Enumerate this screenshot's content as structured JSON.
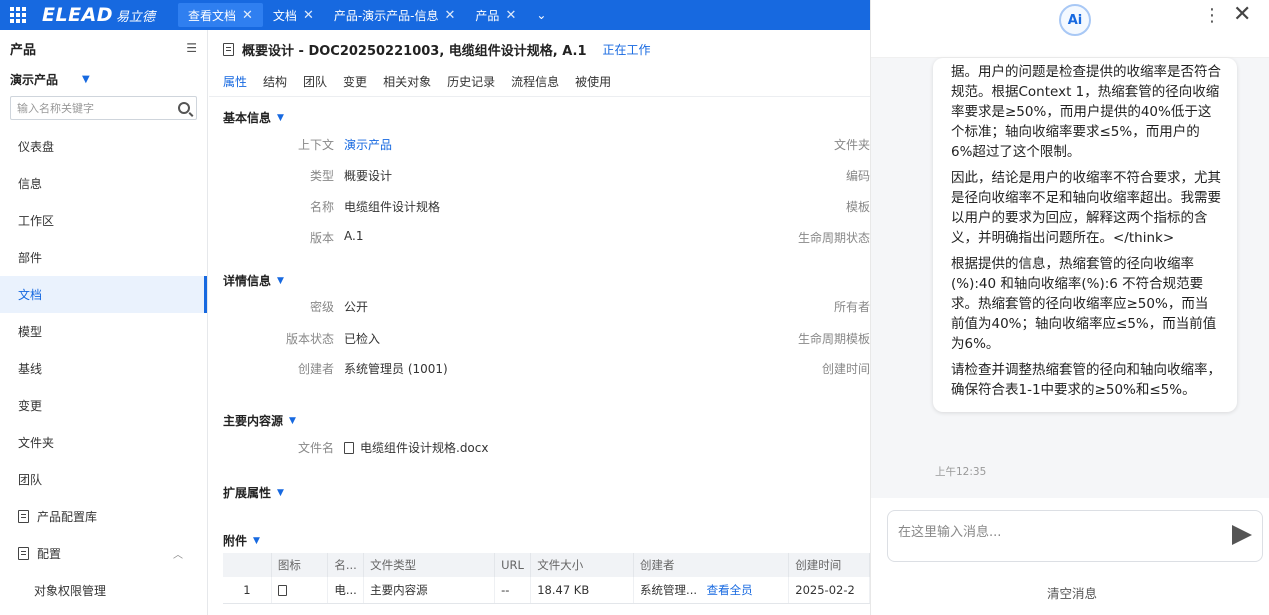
{
  "topbar": {
    "brand": "ELEAD",
    "brand_cn": "易立德",
    "tabs": [
      {
        "label": "查看文档",
        "active": true
      },
      {
        "label": "文档",
        "active": false
      },
      {
        "label": "产品-演示产品-信息",
        "active": false
      },
      {
        "label": "产品",
        "active": false
      }
    ]
  },
  "sidebar": {
    "title": "产品",
    "product": "演示产品",
    "search_placeholder": "输入名称关键字",
    "items": [
      {
        "label": "仪表盘"
      },
      {
        "label": "信息"
      },
      {
        "label": "工作区"
      },
      {
        "label": "部件"
      },
      {
        "label": "文档",
        "active": true
      },
      {
        "label": "模型"
      },
      {
        "label": "基线"
      },
      {
        "label": "变更"
      },
      {
        "label": "文件夹"
      },
      {
        "label": "团队"
      },
      {
        "label": "产品配置库"
      },
      {
        "label": "配置"
      },
      {
        "label": "对象权限管理"
      }
    ]
  },
  "doc": {
    "title": "概要设计 - DOC20250221003, 电缆组件设计规格, A.1",
    "status": "正在工作",
    "tabs": [
      "属性",
      "结构",
      "团队",
      "变更",
      "相关对象",
      "历史记录",
      "流程信息",
      "被使用"
    ]
  },
  "basic": {
    "heading": "基本信息",
    "context_label": "上下文",
    "context_value": "演示产品",
    "type_label": "类型",
    "type_value": "概要设计",
    "name_label": "名称",
    "name_value": "电缆组件设计规格",
    "version_label": "版本",
    "version_value": "A.1",
    "r_folder": "文件夹",
    "r_code": "编码",
    "r_template": "模板",
    "r_lifecycle_state": "生命周期状态"
  },
  "detail": {
    "heading": "详情信息",
    "secret_label": "密级",
    "secret_value": "公开",
    "vstate_label": "版本状态",
    "vstate_value": "已检入",
    "creator_label": "创建者",
    "creator_value": "系统管理员 (1001)",
    "r_owner": "所有者",
    "r_lifecycle_template": "生命周期模板",
    "r_created": "创建时间"
  },
  "main_source": {
    "heading": "主要内容源",
    "file_label": "文件名",
    "file_value": "电缆组件设计规格.docx"
  },
  "ext": {
    "heading": "扩展属性"
  },
  "attachments": {
    "heading": "附件",
    "columns": [
      "",
      "图标",
      "名...",
      "文件类型",
      "URL",
      "文件大小",
      "创建者",
      "创建时间"
    ],
    "rows": [
      {
        "no": "1",
        "name": "电...",
        "type": "主要内容源",
        "url": "--",
        "size": "18.47 KB",
        "creator": "系统管理...",
        "view": "查看全员",
        "created": "2025-02-2"
      }
    ]
  },
  "ai": {
    "logo": "Ai",
    "messages": [
      "据。用户的问题是检查提供的收缩率是否符合规范。根据Context 1，热缩套管的径向收缩率要求是≥50%，而用户提供的40%低于这个标准；轴向收缩率要求≤5%，而用户的6%超过了这个限制。",
      "因此，结论是用户的收缩率不符合要求，尤其是径向收缩率不足和轴向收缩率超出。我需要以用户的要求为回应，解释这两个指标的含义，并明确指出问题所在。</think>",
      "根据提供的信息，热缩套管的径向收缩率(%):40 和轴向收缩率(%):6 不符合规范要求。热缩套管的径向收缩率应≥50%，而当前值为40%；轴向收缩率应≤5%，而当前值为6%。",
      "请检查并调整热缩套管的径向和轴向收缩率，确保符合表1-1中要求的≥50%和≤5%。"
    ],
    "time": "上午12:35",
    "input_placeholder": "在这里输入消息...",
    "clear_label": "清空消息"
  }
}
